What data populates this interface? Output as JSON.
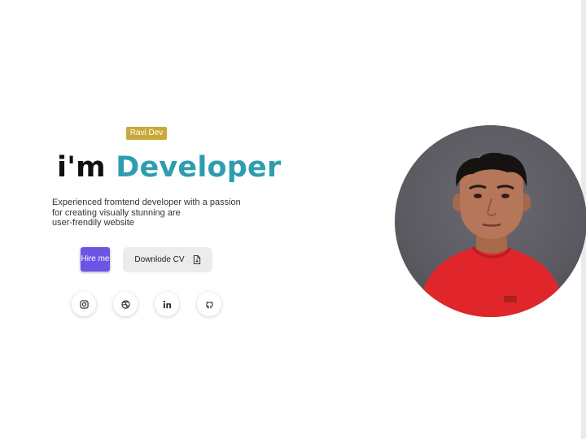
{
  "hero": {
    "badge": "Ravi Dev",
    "headline_prefix": "i'm",
    "headline_highlight": "Developer",
    "tagline_lines": [
      "Experienced fromtend developer with a passion",
      "for creating visually stunning are",
      "user-frendily website"
    ],
    "hire_label": "Hire me",
    "cv_label": "Downlode CV"
  },
  "social": [
    {
      "icon": "instagram-icon"
    },
    {
      "icon": "dribbble-icon"
    },
    {
      "icon": "linkedin-icon"
    },
    {
      "icon": "github-icon"
    }
  ],
  "colors": {
    "badge": "#c9a93a",
    "highlight": "#2f9db0",
    "hire_button": "#6b55e6",
    "cv_button": "#ececec",
    "photo_shirt": "#e0262a"
  }
}
